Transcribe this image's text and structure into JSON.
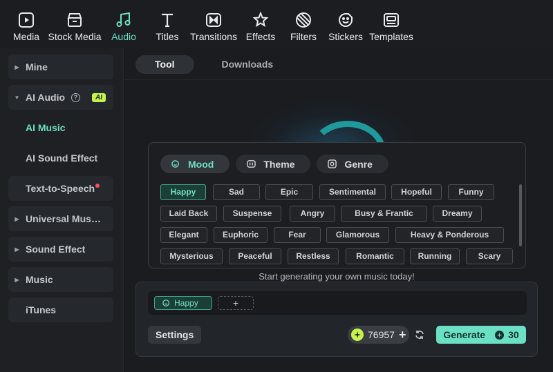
{
  "toolbar": {
    "items": [
      {
        "label": "Media",
        "icon": "media-icon"
      },
      {
        "label": "Stock Media",
        "icon": "stock-media-icon"
      },
      {
        "label": "Audio",
        "icon": "music-note-icon",
        "active": true
      },
      {
        "label": "Titles",
        "icon": "text-t-icon"
      },
      {
        "label": "Transitions",
        "icon": "transitions-icon"
      },
      {
        "label": "Effects",
        "icon": "effects-star-icon"
      },
      {
        "label": "Filters",
        "icon": "filters-icon"
      },
      {
        "label": "Stickers",
        "icon": "sticker-icon"
      },
      {
        "label": "Templates",
        "icon": "templates-icon"
      }
    ]
  },
  "sidebar": {
    "mine": "Mine",
    "ai_audio": "AI Audio",
    "ai_badge": "AI",
    "ai_music": "AI Music",
    "ai_sound_effect": "AI Sound Effect",
    "text_to_speech": "Text-to-Speech",
    "universal_music": "Universal Musi...",
    "sound_effect": "Sound Effect",
    "music": "Music",
    "itunes": "iTunes"
  },
  "tabs": {
    "tool": "Tool",
    "downloads": "Downloads"
  },
  "categories": {
    "mood": "Mood",
    "theme": "Theme",
    "genre": "Genre"
  },
  "tags": {
    "row1": [
      "Happy",
      "Sad",
      "Epic",
      "Sentimental",
      "Hopeful",
      "Funny"
    ],
    "row2": [
      "Laid Back",
      "Suspense",
      "Angry",
      "Busy & Frantic",
      "Dreamy"
    ],
    "row3": [
      "Elegant",
      "Euphoric",
      "Fear",
      "Glamorous",
      "Heavy & Ponderous"
    ],
    "row4": [
      "Mysterious",
      "Peaceful",
      "Restless",
      "Romantic",
      "Running",
      "Scary"
    ]
  },
  "prompt_text": "Start generating your own music today!",
  "composer": {
    "selected_chip": "Happy",
    "add_symbol": "+",
    "settings_label": "Settings",
    "credits": "76957",
    "generate_label": "Generate",
    "generate_cost": "30"
  },
  "colors": {
    "accent": "#6ce0c4",
    "ai_badge": "#c6f24e",
    "notification_dot": "#f2535b"
  }
}
